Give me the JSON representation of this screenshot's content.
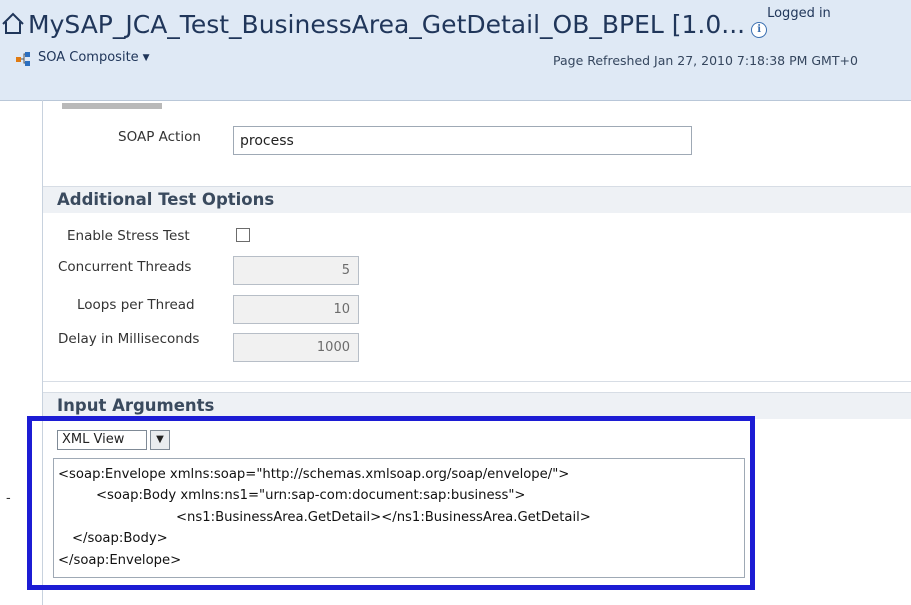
{
  "header": {
    "title": "MySAP_JCA_Test_BusinessArea_GetDetail_OB_BPEL [1.0...",
    "logged_in": "Logged in",
    "composite_menu": "SOA Composite",
    "refreshed": "Page Refreshed Jan 27, 2010 7:18:38 PM GMT+0"
  },
  "soap": {
    "label": "SOAP Action",
    "value": "process"
  },
  "additional_options": {
    "title": "Additional Test Options",
    "enable_stress_label": "Enable Stress Test",
    "enable_stress_checked": false,
    "threads_label": "Concurrent Threads",
    "threads_value": "5",
    "loops_label": "Loops per Thread",
    "loops_value": "10",
    "delay_label": "Delay in Milliseconds",
    "delay_value": "1000"
  },
  "input_arguments": {
    "title": "Input Arguments",
    "view_select": "XML View",
    "xml_lines": [
      "<soap:Envelope xmlns:soap=\"http://schemas.xmlsoap.org/soap/envelope/\">",
      "<soap:Body xmlns:ns1=\"urn:sap-com:document:sap:business\">",
      "<ns1:BusinessArea.GetDetail></ns1:BusinessArea.GetDetail>",
      "</soap:Body>",
      "</soap:Envelope>"
    ]
  },
  "colors": {
    "highlight": "#1c1cd4",
    "header_bg": "#dfe9f5",
    "section_bg": "#eef1f5"
  }
}
